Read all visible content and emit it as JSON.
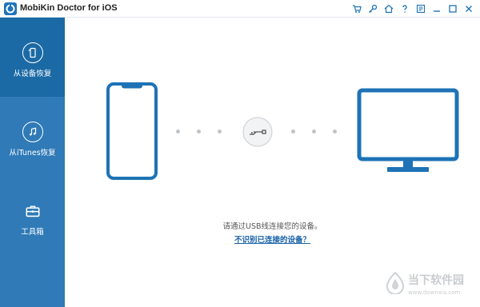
{
  "window": {
    "title": "MobiKin Doctor for iOS"
  },
  "toolbar_icons": [
    "cart-icon",
    "key-icon",
    "home-icon",
    "help-icon",
    "register-icon",
    "minimize-icon",
    "maximize-icon",
    "close-icon"
  ],
  "sidebar": {
    "items": [
      {
        "label": "从设备恢复",
        "icon": "phone-recover-icon",
        "active": true
      },
      {
        "label": "从iTunes恢复",
        "icon": "itunes-music-icon",
        "active": false
      },
      {
        "label": "工具箱",
        "icon": "toolbox-icon",
        "active": false
      }
    ]
  },
  "main": {
    "instruction": "请通过USB线连接您的设备。",
    "help_link": "不识别已连接的设备？"
  },
  "watermark": {
    "brand": "当下软件园",
    "url": "www.downxia.com"
  },
  "colors": {
    "sidebar": "#2f7ab7",
    "sidebar_active": "#1b6aa5",
    "device_outline": "#1d73b5",
    "link": "#1a62a8"
  }
}
